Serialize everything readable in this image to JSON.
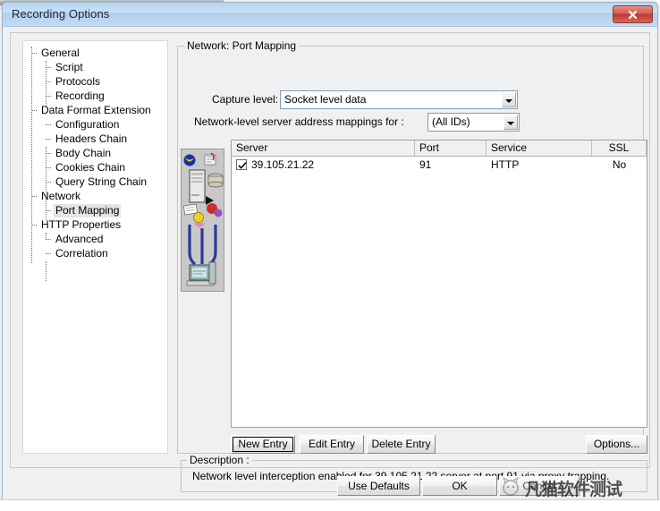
{
  "window": {
    "title": "Recording Options",
    "close_icon": "close-icon"
  },
  "tree": {
    "items": [
      {
        "label": "General",
        "level": 0,
        "selected": false
      },
      {
        "label": "Script",
        "level": 1,
        "selected": false
      },
      {
        "label": "Protocols",
        "level": 1,
        "selected": false
      },
      {
        "label": "Recording",
        "level": 1,
        "selected": false
      },
      {
        "label": "Data Format Extension",
        "level": 0,
        "selected": false
      },
      {
        "label": "Configuration",
        "level": 1,
        "selected": false
      },
      {
        "label": "Headers Chain",
        "level": 1,
        "selected": false
      },
      {
        "label": "Body Chain",
        "level": 1,
        "selected": false
      },
      {
        "label": "Cookies Chain",
        "level": 1,
        "selected": false
      },
      {
        "label": "Query String Chain",
        "level": 1,
        "selected": false
      },
      {
        "label": "Network",
        "level": 0,
        "selected": false
      },
      {
        "label": "Port Mapping",
        "level": 1,
        "selected": true
      },
      {
        "label": "HTTP Properties",
        "level": 0,
        "selected": false
      },
      {
        "label": "Advanced",
        "level": 1,
        "selected": false
      },
      {
        "label": "Correlation",
        "level": 1,
        "selected": false
      }
    ]
  },
  "panel": {
    "group_title": "Network: Port Mapping",
    "capture_level_label": "Capture level:",
    "capture_level_value": "Socket level data",
    "mappings_label": "Network-level server address mappings for :",
    "mappings_value": "(All IDs)",
    "illustration_icon": "network-diagram-icon"
  },
  "table": {
    "columns": [
      "Server",
      "Port",
      "Service",
      "SSL"
    ],
    "rows": [
      {
        "checked": true,
        "server": "39.105.21.22",
        "port": "91",
        "service": "HTTP",
        "ssl": "No"
      }
    ]
  },
  "entry_buttons": {
    "new": "New Entry",
    "edit": "Edit Entry",
    "delete": "Delete Entry",
    "options": "Options..."
  },
  "description": {
    "title": "Description :",
    "text": "Network level interception enabled for 39.105.21.22 server at port 91 via proxy trapping."
  },
  "footer": {
    "use_defaults": "Use Defaults",
    "ok": "OK",
    "cancel": "Cancel"
  },
  "watermark": {
    "text": "凡猫软件测试",
    "logo_icon": "cat-logo-icon"
  },
  "colors": {
    "titlebar": "#c3daf0",
    "close_button": "#bb3a2c",
    "dialog_bg": "#f0f0f0",
    "selection": "#e4e4e4",
    "table_bg": "#ffffff"
  }
}
